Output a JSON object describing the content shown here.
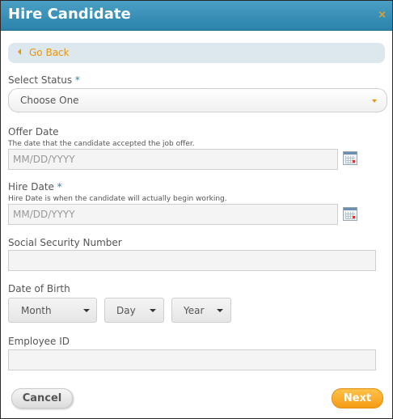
{
  "dialog": {
    "title": "Hire Candidate",
    "close_glyph": "×",
    "close_icon": "close-icon"
  },
  "nav": {
    "back_label": "Go Back",
    "back_icon": "chevron-left-icon"
  },
  "form": {
    "status": {
      "label": "Select Status",
      "required_mark": "*",
      "selected": "Choose One",
      "icon": "chevron-down-icon"
    },
    "offer_date": {
      "label": "Offer Date",
      "help": "The date that the candidate accepted the job offer.",
      "value": "",
      "placeholder": "MM/DD/YYYY",
      "icon": "calendar-icon"
    },
    "hire_date": {
      "label": "Hire Date",
      "required_mark": "*",
      "help": "Hire Date is when the candidate will actually begin working.",
      "value": "",
      "placeholder": "MM/DD/YYYY",
      "icon": "calendar-icon"
    },
    "ssn": {
      "label": "Social Security Number",
      "value": ""
    },
    "dob": {
      "label": "Date of Birth",
      "month": "Month",
      "day": "Day",
      "year": "Year",
      "icon": "chevron-down-icon"
    },
    "employee_id": {
      "label": "Employee ID",
      "value": ""
    }
  },
  "actions": {
    "cancel_label": "Cancel",
    "next_label": "Next"
  },
  "colors": {
    "titlebar": "#2b83ab",
    "accent": "#e8960c",
    "required": "#2b83ab"
  }
}
